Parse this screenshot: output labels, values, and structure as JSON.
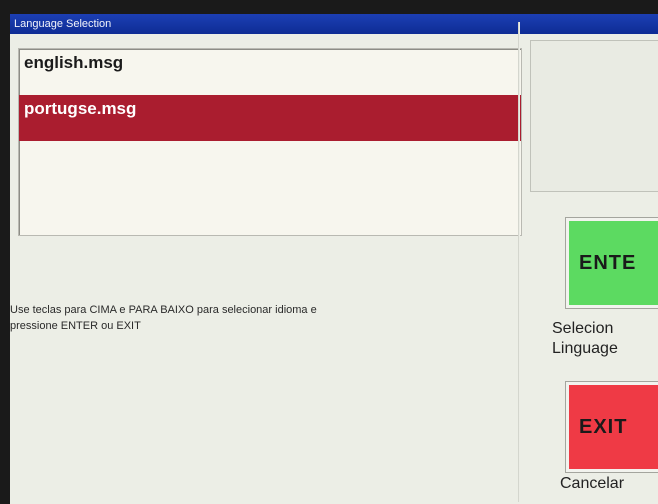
{
  "window": {
    "title": "Language Selection"
  },
  "language_list": {
    "items": [
      {
        "label": "english.msg",
        "selected": false
      },
      {
        "label": "portugse.msg",
        "selected": true
      }
    ]
  },
  "instructions": {
    "line1": "Use teclas para CIMA e PARA BAIXO para selecionar idioma e",
    "line2": "pressione ENTER ou EXIT"
  },
  "function_keys": {
    "enter": {
      "label": "ENTE",
      "caption_line1": "Selecion",
      "caption_line2": "Linguage"
    },
    "exit": {
      "label": "EXIT",
      "caption_line1": "Cancelar"
    }
  },
  "colors": {
    "title_bar": "#1c3fb4",
    "selection": "#aa1d2f",
    "enter_key": "#5cda61",
    "exit_key": "#ef3a45"
  }
}
